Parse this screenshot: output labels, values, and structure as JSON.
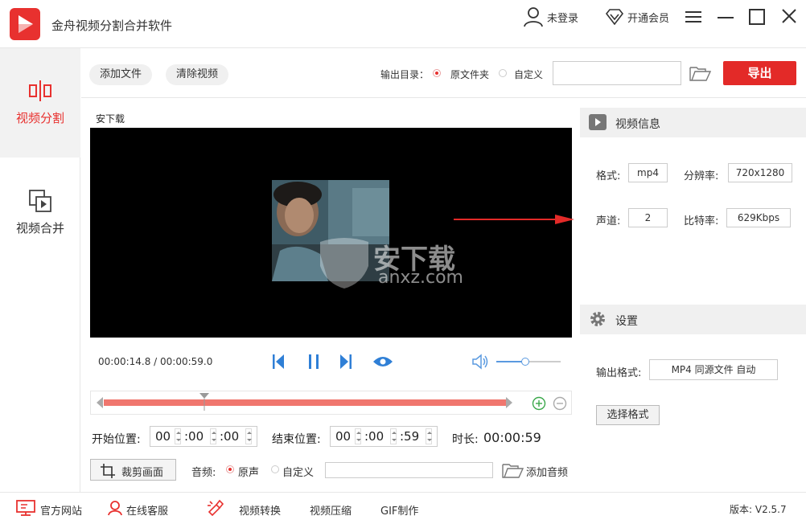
{
  "app": {
    "title": "金舟视频分割合并软件",
    "login": "未登录",
    "vip": "开通会员",
    "accent": "#e8312f"
  },
  "sidebar": {
    "items": [
      {
        "label": "视频分割",
        "icon": "split-icon",
        "active": true
      },
      {
        "label": "视频合并",
        "icon": "merge-icon",
        "active": false
      }
    ]
  },
  "toolbar": {
    "add_file": "添加文件",
    "clear_video": "清除视频",
    "output_dir_label": "输出目录：",
    "option_source": "原文件夹",
    "option_custom": "自定义",
    "output_path": "",
    "export": "导出"
  },
  "player": {
    "file_name": "安下载",
    "time_current": "00:00:14.8",
    "time_total": "00:00:59.0",
    "watermark_cn": "安下载",
    "watermark_en": "anxz.com",
    "volume": 0.45,
    "playhead": 0.25
  },
  "positions": {
    "start_label": "开始位置:",
    "start": [
      "00",
      ":00",
      ":00"
    ],
    "end_label": "结束位置:",
    "end": [
      "00",
      ":00",
      ":59"
    ],
    "duration_label": "时长:",
    "duration": "00:00:59"
  },
  "crop": {
    "crop_button": "裁剪画面",
    "audio_label": "音频:",
    "audio_original": "原声",
    "audio_custom": "自定义",
    "audio_path": "",
    "add_audio": "添加音频"
  },
  "video_info": {
    "header": "视频信息",
    "format_label": "格式:",
    "format": "mp4",
    "resolution_label": "分辨率:",
    "resolution": "720x1280",
    "channel_label": "声道:",
    "channel": "2",
    "bitrate_label": "比特率:",
    "bitrate": "629Kbps"
  },
  "settings": {
    "header": "设置",
    "output_format_label": "输出格式:",
    "output_format": "MP4 同源文件 自动",
    "choose_format": "选择格式"
  },
  "footer": {
    "website": "官方网站",
    "support": "在线客服",
    "convert": "视频转换",
    "compress": "视频压缩",
    "gif": "GIF制作",
    "version": "版本: V2.5.7"
  }
}
